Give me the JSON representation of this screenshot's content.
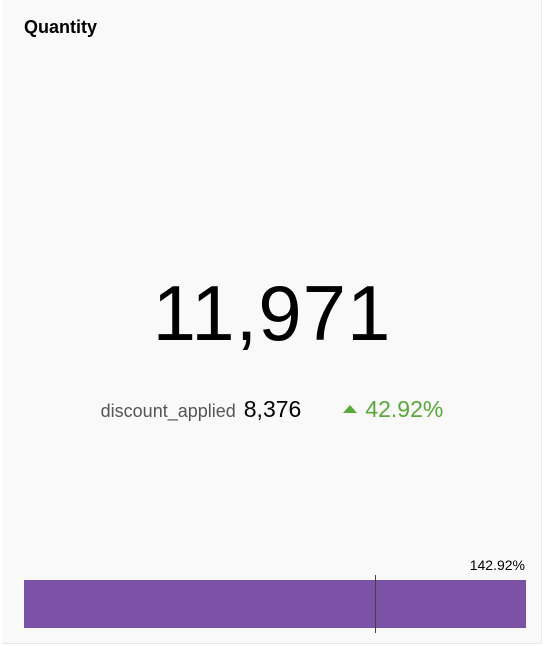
{
  "card": {
    "title": "Quantity",
    "value": "11,971",
    "comparison": {
      "label": "discount_applied",
      "value": "8,376",
      "change": "42.92%",
      "direction": "up",
      "change_color": "#5aa73a",
      "icon": "triangle-up-icon"
    },
    "progress": {
      "label": "142.92%",
      "ratio": 1.4292,
      "fill_color": "#7b52a6"
    }
  }
}
